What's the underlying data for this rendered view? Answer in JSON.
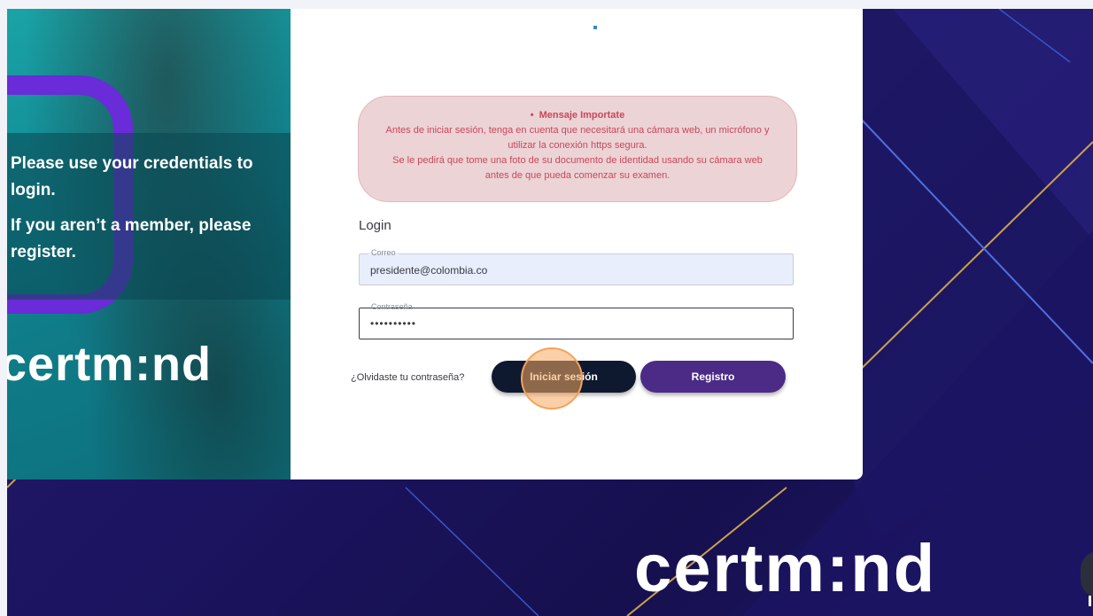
{
  "hero": {
    "line1": "Please use your credentials to login.",
    "line2": "If you aren’t a member, please register.",
    "logo_text": "certm:nd"
  },
  "alert": {
    "title": "Mensaje Importate",
    "body1": "Antes de iniciar sesión, tenga en cuenta que necesitará una cámara web, un micrófono y utilizar la conexión https segura.",
    "body2": "Se le pedirá que tome una foto de su documento de identidad usando su cámara web antes de que pueda comenzar su examen.",
    "color": "#c9475b"
  },
  "login": {
    "title": "Login",
    "email_label": "Correo",
    "email_value": "presidente@colombia.co",
    "password_label": "Contraseña",
    "password_value": "••••••••••",
    "forgot_link": "¿Olvidaste tu contraseña?",
    "login_button": "Iniciar sesión",
    "register_button": "Registro"
  },
  "footer": {
    "logo_text": "certm:nd"
  },
  "colors": {
    "background": "#1c1460",
    "login_button": "#0e1930",
    "register_button": "#4b2b86",
    "accent": "#6a2bd8"
  }
}
